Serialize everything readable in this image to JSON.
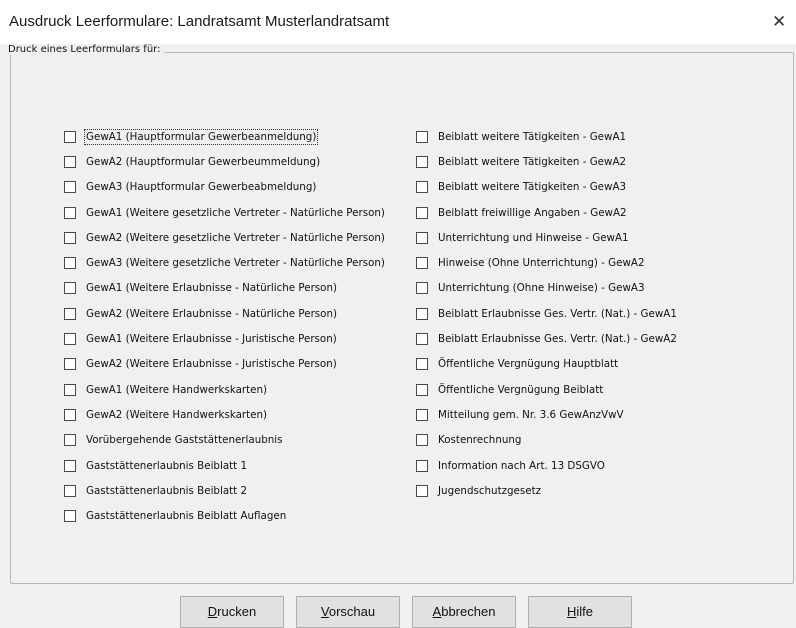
{
  "window": {
    "title": "Ausdruck Leerformulare: Landratsamt Musterlandratsamt",
    "close_glyph": "✕"
  },
  "group": {
    "legend": "Druck eines Leerformulars für:"
  },
  "left_column": [
    {
      "label": "GewA1 (Hauptformular Gewerbeanmeldung)",
      "checked": false,
      "focused": true
    },
    {
      "label": "GewA2 (Hauptformular Gewerbeummeldung)",
      "checked": false
    },
    {
      "label": "GewA3 (Hauptformular Gewerbeabmeldung)",
      "checked": false
    },
    {
      "label": "GewA1 (Weitere gesetzliche Vertreter - Natürliche Person)",
      "checked": false
    },
    {
      "label": "GewA2 (Weitere gesetzliche Vertreter - Natürliche Person)",
      "checked": false
    },
    {
      "label": "GewA3 (Weitere gesetzliche Vertreter - Natürliche Person)",
      "checked": false
    },
    {
      "label": "GewA1 (Weitere Erlaubnisse - Natürliche Person)",
      "checked": false
    },
    {
      "label": "GewA2 (Weitere Erlaubnisse - Natürliche Person)",
      "checked": false
    },
    {
      "label": "GewA1 (Weitere Erlaubnisse - Juristische Person)",
      "checked": false
    },
    {
      "label": "GewA2 (Weitere Erlaubnisse - Juristische Person)",
      "checked": false
    },
    {
      "label": "GewA1 (Weitere Handwerkskarten)",
      "checked": false
    },
    {
      "label": "GewA2 (Weitere Handwerkskarten)",
      "checked": false
    },
    {
      "label": "Vorübergehende Gaststättenerlaubnis",
      "checked": false
    },
    {
      "label": "Gaststättenerlaubnis Beiblatt 1",
      "checked": false
    },
    {
      "label": "Gaststättenerlaubnis Beiblatt 2",
      "checked": false
    },
    {
      "label": "Gaststättenerlaubnis Beiblatt Auflagen",
      "checked": false
    }
  ],
  "right_column": [
    {
      "label": "Beiblatt weitere Tätigkeiten - GewA1",
      "checked": false
    },
    {
      "label": "Beiblatt weitere Tätigkeiten - GewA2",
      "checked": false
    },
    {
      "label": "Beiblatt weitere Tätigkeiten - GewA3",
      "checked": false
    },
    {
      "label": "Beiblatt freiwillige Angaben - GewA2",
      "checked": false
    },
    {
      "label": "Unterrichtung und Hinweise - GewA1",
      "checked": false
    },
    {
      "label": "Hinweise (Ohne Unterrichtung) - GewA2",
      "checked": false
    },
    {
      "label": "Unterrichtung (Ohne Hinweise) - GewA3",
      "checked": false
    },
    {
      "label": "Beiblatt Erlaubnisse Ges. Vertr. (Nat.) - GewA1",
      "checked": false
    },
    {
      "label": "Beiblatt Erlaubnisse Ges. Vertr. (Nat.) - GewA2",
      "checked": false
    },
    {
      "label": "Öffentliche Vergnügung Hauptblatt",
      "checked": false
    },
    {
      "label": "Öffentliche Vergnügung Beiblatt",
      "checked": false
    },
    {
      "label": "Mitteilung gem. Nr. 3.6 GewAnzVwV",
      "checked": false
    },
    {
      "label": "Kostenrechnung",
      "checked": false
    },
    {
      "label": "Information nach Art. 13 DSGVO",
      "checked": false
    },
    {
      "label": "Jugendschutzgesetz",
      "checked": false
    }
  ],
  "buttons": {
    "drucken": {
      "accel": "D",
      "rest": "rucken"
    },
    "vorschau": {
      "accel": "V",
      "rest": "orschau"
    },
    "abbrechen": {
      "accel": "A",
      "rest": "bbrechen"
    },
    "hilfe": {
      "accel": "H",
      "rest": "ilfe"
    }
  }
}
